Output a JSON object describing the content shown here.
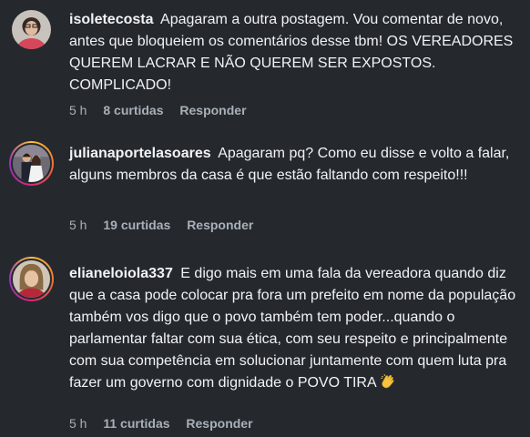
{
  "comments": [
    {
      "username": "isoletecosta",
      "text": "Apagaram a outra postagem. Vou comentar de novo, antes que bloqueiem os comentários desse tbm! OS VEREADORES QUEREM LACRAR E NÃO QUEREM SER EXPOSTOS. COMPLICADO!",
      "time": "5 h",
      "likes": "8 curtidas",
      "reply": "Responder",
      "avatar_icon": "avatar-woman-icon"
    },
    {
      "username": "julianaportelasoares",
      "text": "Apagaram pq? Como eu disse e volto a falar, alguns membros da casa é que estão faltando com respeito!!!",
      "time": "5 h",
      "likes": "19 curtidas",
      "reply": "Responder",
      "avatar_icon": "avatar-couple-icon"
    },
    {
      "username": "elianeloiola337",
      "text": "E digo mais em uma fala da vereadora quando diz que a casa pode colocar pra fora um prefeito em nome da população também vos digo que o povo também tem poder...quando o parlamentar faltar com sua ética, com seu respeito e principalmente com sua competência em solucionar juntamente com quem luta pra fazer um governo com dignidade o POVO TIRA",
      "emoji": "clapping-hands-icon",
      "time": "5 h",
      "likes": "11 curtidas",
      "reply": "Responder",
      "avatar_icon": "avatar-woman-blonde-icon"
    }
  ]
}
